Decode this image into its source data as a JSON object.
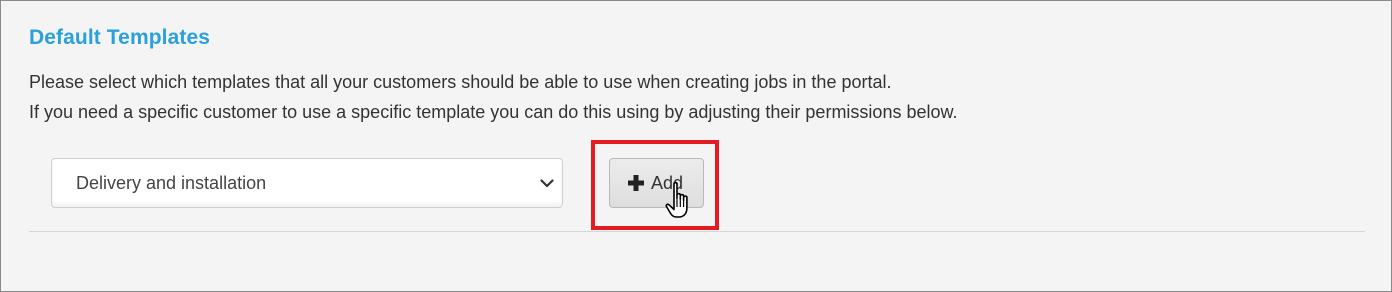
{
  "section": {
    "title": "Default Templates",
    "description_lines": [
      "Please select which templates that all your customers should be able to use when creating jobs in the portal.",
      "If you need a specific customer to use a specific template you can do this using by adjusting their permissions below."
    ]
  },
  "template_select": {
    "selected": "Delivery and installation"
  },
  "add_button": {
    "label": "Add",
    "icon": "plus-icon"
  },
  "colors": {
    "title": "#2aa0dc",
    "highlight": "#e31b23",
    "panel_background": "#f4f4f4"
  }
}
